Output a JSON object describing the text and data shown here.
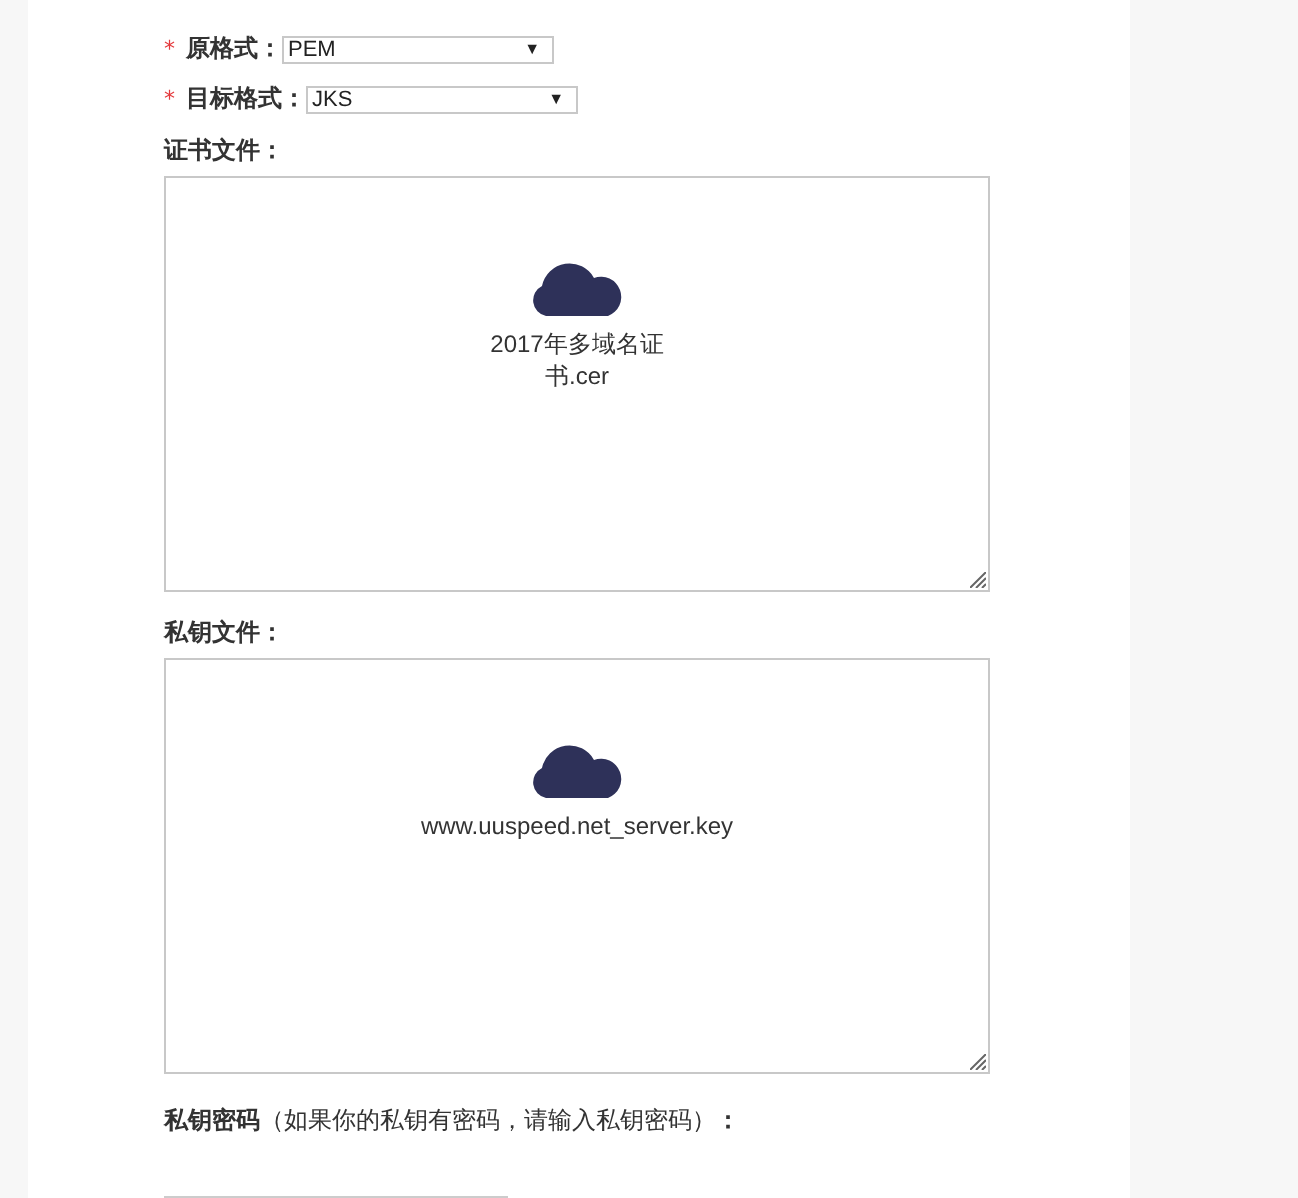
{
  "format_fields": [
    {
      "required_mark": "*",
      "label": "原格式：",
      "value": "PEM",
      "caret": "▼"
    },
    {
      "required_mark": "*",
      "label": "目标格式：",
      "value": "JKS",
      "caret": "▼"
    }
  ],
  "upload_areas": [
    {
      "label": "证书文件：",
      "file_name": "2017年多域名证书.cer"
    },
    {
      "label": "私钥文件：",
      "file_name": "www.uuspeed.net_server.key"
    }
  ],
  "password": {
    "label": "私钥密码",
    "hint": "（如果你的私钥有密码，请输入私钥密码）",
    "suffix": "："
  }
}
